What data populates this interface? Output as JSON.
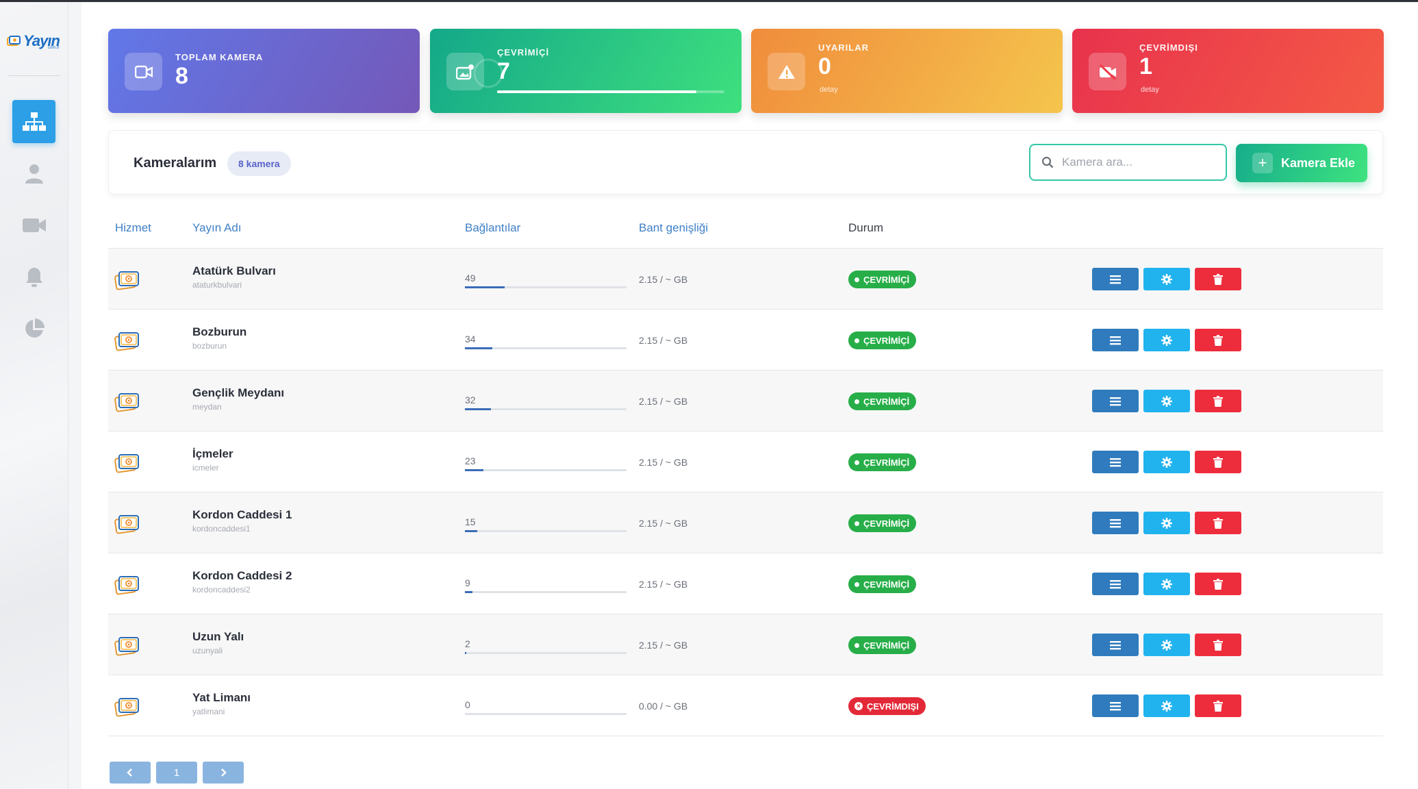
{
  "app": {
    "logo_text": "Yayın",
    "logo_sub": "com.tr"
  },
  "sidebar": {
    "items": [
      {
        "icon": "sitemap-icon",
        "active": true
      },
      {
        "icon": "user-icon",
        "active": false
      },
      {
        "icon": "video-camera-icon",
        "active": false
      },
      {
        "icon": "bell-icon",
        "active": false
      },
      {
        "icon": "pie-chart-icon",
        "active": false
      }
    ]
  },
  "stats": {
    "total": {
      "label": "TOPLAM KAMERA",
      "value": "8"
    },
    "online": {
      "label": "ÇEVRİMİÇİ",
      "value": "7",
      "progress": 0.875
    },
    "warnings": {
      "label": "UYARILAR",
      "value": "0",
      "detail": "detay"
    },
    "offline": {
      "label": "ÇEVRİMDIŞI",
      "value": "1",
      "detail": "detay"
    }
  },
  "header": {
    "title": "Kameralarım",
    "count_badge": "8 kamera",
    "search_placeholder": "Kamera ara...",
    "add_button": "Kamera Ekle"
  },
  "table": {
    "columns": {
      "service": "Hizmet",
      "name": "Yayın Adı",
      "connections": "Bağlantılar",
      "bandwidth": "Bant genişliği",
      "status": "Durum"
    },
    "max_connections": 200,
    "rows": [
      {
        "name": "Atatürk Bulvarı",
        "slug": "ataturkbulvari",
        "connections": "49",
        "bandwidth": "2.15 / ~ GB",
        "status": "ÇEVRİMİÇİ",
        "online": true
      },
      {
        "name": "Bozburun",
        "slug": "bozburun",
        "connections": "34",
        "bandwidth": "2.15 / ~ GB",
        "status": "ÇEVRİMİÇİ",
        "online": true
      },
      {
        "name": "Gençlik Meydanı",
        "slug": "meydan",
        "connections": "32",
        "bandwidth": "2.15 / ~ GB",
        "status": "ÇEVRİMİÇİ",
        "online": true
      },
      {
        "name": "İçmeler",
        "slug": "icmeler",
        "connections": "23",
        "bandwidth": "2.15 / ~ GB",
        "status": "ÇEVRİMİÇİ",
        "online": true
      },
      {
        "name": "Kordon Caddesi 1",
        "slug": "kordoncaddesi1",
        "connections": "15",
        "bandwidth": "2.15 / ~ GB",
        "status": "ÇEVRİMİÇİ",
        "online": true
      },
      {
        "name": "Kordon Caddesi 2",
        "slug": "kordoncaddesi2",
        "connections": "9",
        "bandwidth": "2.15 / ~ GB",
        "status": "ÇEVRİMİÇİ",
        "online": true
      },
      {
        "name": "Uzun Yalı",
        "slug": "uzunyali",
        "connections": "2",
        "bandwidth": "2.15 / ~ GB",
        "status": "ÇEVRİMİÇİ",
        "online": true
      },
      {
        "name": "Yat Limanı",
        "slug": "yatlimani",
        "connections": "0",
        "bandwidth": "0.00 / ~ GB",
        "status": "ÇEVRİMDIŞI",
        "online": false
      }
    ]
  },
  "pagination": {
    "prev": "‹",
    "current": "1",
    "next": "›"
  },
  "colors": {
    "accent": "#2c9fe6",
    "online": "#27ae48",
    "offline": "#e32937",
    "menu_button": "#2f7bbd",
    "settings_button": "#21b3ee",
    "delete_button": "#ee2d3c"
  }
}
